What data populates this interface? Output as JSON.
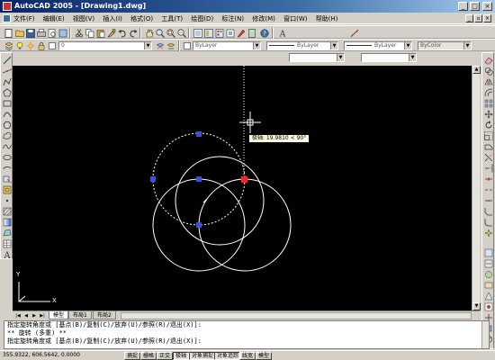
{
  "window": {
    "title": "AutoCAD 2005 - [Drawing1.dwg]",
    "minimize_glyph": "_",
    "maximize_glyph": "□",
    "close_glyph": "×"
  },
  "menu": {
    "items": [
      "文件(F)",
      "编辑(E)",
      "视图(V)",
      "插入(I)",
      "格式(O)",
      "工具(T)",
      "绘图(D)",
      "标注(N)",
      "修改(M)",
      "窗口(W)",
      "帮助(H)"
    ]
  },
  "properties_toolbar": {
    "layer_value": "0",
    "color_value": "ByLayer",
    "linetype_value": "ByLayer",
    "lineweight_value": "ByLayer",
    "plotstyle_value": "ByColor"
  },
  "canvas": {
    "background": "#000000",
    "tooltip_text": "极轴: 19.9810 < 90°",
    "ucs_x_label": "X",
    "ucs_y_label": "Y",
    "crosshair_color": "#ffffff",
    "grip_color": "#3b4fd8",
    "hot_grip_color": "#ff2020",
    "circle_color": "#ffffff"
  },
  "layout_tabs": {
    "tabs": [
      "模型",
      "布局1",
      "布局2"
    ],
    "active": "模型"
  },
  "command": {
    "lines": [
      "指定旋转角度或 [基点(B)/复制(C)/放弃(U)/参照(R)/退出(X)]:",
      "** 旋转 (多重) **",
      "指定旋转角度或 [基点(B)/复制(C)/放弃(U)/参照(R)/退出(X)]:"
    ]
  },
  "status": {
    "coordinates": "355.9322, 606.5642, 0.0000",
    "modes": [
      {
        "label": "捕捉",
        "on": false
      },
      {
        "label": "栅格",
        "on": false
      },
      {
        "label": "正交",
        "on": false
      },
      {
        "label": "极轴",
        "on": true
      },
      {
        "label": "对象捕捉",
        "on": true
      },
      {
        "label": "对象追踪",
        "on": true
      },
      {
        "label": "线宽",
        "on": false
      },
      {
        "label": "模型",
        "on": false
      }
    ]
  }
}
